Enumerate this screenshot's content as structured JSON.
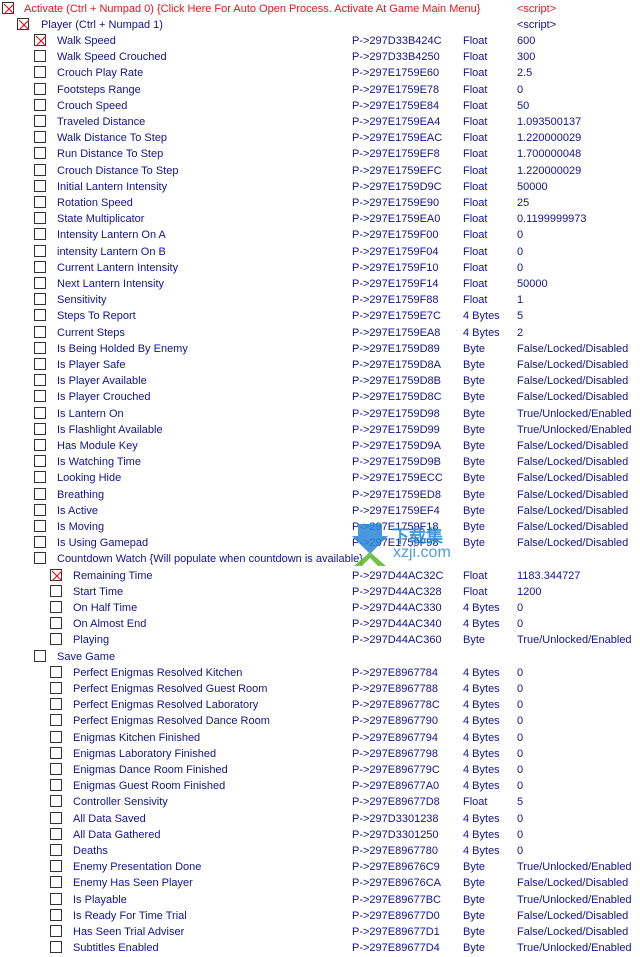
{
  "colors": {
    "text": "#14148c",
    "script_row": "#e8141e",
    "check_x": "#e8141e"
  },
  "watermark": {
    "line1": "下载集",
    "line2": "xzji.com"
  },
  "rows": [
    {
      "level": 0,
      "checked": true,
      "red": true,
      "desc": "Activate (Ctrl + Numpad 0) {Click Here For Auto Open Process. Activate At Game Main Menu}",
      "addr": "",
      "type": "",
      "value": "<script>"
    },
    {
      "level": 1,
      "checked": true,
      "desc": "Player (Ctrl + Numpad 1)",
      "addr": "",
      "type": "",
      "value": "<script>"
    },
    {
      "level": 2,
      "checked": true,
      "desc": "Walk Speed",
      "addr": "P->297D33B424C",
      "type": "Float",
      "value": "600"
    },
    {
      "level": 2,
      "desc": "Walk Speed Crouched",
      "addr": "P->297D33B4250",
      "type": "Float",
      "value": "300"
    },
    {
      "level": 2,
      "desc": "Crouch Play Rate",
      "addr": "P->297E1759E60",
      "type": "Float",
      "value": "2.5"
    },
    {
      "level": 2,
      "desc": "Footsteps Range",
      "addr": "P->297E1759E78",
      "type": "Float",
      "value": "0"
    },
    {
      "level": 2,
      "desc": "Crouch Speed",
      "addr": "P->297E1759E84",
      "type": "Float",
      "value": "50"
    },
    {
      "level": 2,
      "desc": "Traveled Distance",
      "addr": "P->297E1759EA4",
      "type": "Float",
      "value": "1.093500137"
    },
    {
      "level": 2,
      "desc": "Walk Distance To Step",
      "addr": "P->297E1759EAC",
      "type": "Float",
      "value": "1.220000029"
    },
    {
      "level": 2,
      "desc": "Run Distance To Step",
      "addr": "P->297E1759EF8",
      "type": "Float",
      "value": "1.700000048"
    },
    {
      "level": 2,
      "desc": "Crouch Distance To Step",
      "addr": "P->297E1759EFC",
      "type": "Float",
      "value": "1.220000029"
    },
    {
      "level": 2,
      "desc": "Initial Lantern Intensity",
      "addr": "P->297E1759D9C",
      "type": "Float",
      "value": "50000"
    },
    {
      "level": 2,
      "desc": "Rotation Speed",
      "addr": "P->297E1759E90",
      "type": "Float",
      "value": "25"
    },
    {
      "level": 2,
      "desc": "State Multiplicator",
      "addr": "P->297E1759EA0",
      "type": "Float",
      "value": "0.1199999973"
    },
    {
      "level": 2,
      "desc": "Intensity Lantern On A",
      "addr": "P->297E1759F00",
      "type": "Float",
      "value": "0"
    },
    {
      "level": 2,
      "desc": "intensity Lantern On B",
      "addr": "P->297E1759F04",
      "type": "Float",
      "value": "0"
    },
    {
      "level": 2,
      "desc": "Current Lantern Intensity",
      "addr": "P->297E1759F10",
      "type": "Float",
      "value": "0"
    },
    {
      "level": 2,
      "desc": "Next Lantern Intensity",
      "addr": "P->297E1759F14",
      "type": "Float",
      "value": "50000"
    },
    {
      "level": 2,
      "desc": "Sensitivity",
      "addr": "P->297E1759F88",
      "type": "Float",
      "value": "1"
    },
    {
      "level": 2,
      "desc": "Steps To Report",
      "addr": "P->297E1759E7C",
      "type": "4 Bytes",
      "value": "5"
    },
    {
      "level": 2,
      "desc": "Current Steps",
      "addr": "P->297E1759EA8",
      "type": "4 Bytes",
      "value": "2"
    },
    {
      "level": 2,
      "desc": "Is Being Holded By Enemy",
      "addr": "P->297E1759D89",
      "type": "Byte",
      "value": "False/Locked/Disabled"
    },
    {
      "level": 2,
      "desc": "Is Player Safe",
      "addr": "P->297E1759D8A",
      "type": "Byte",
      "value": "False/Locked/Disabled"
    },
    {
      "level": 2,
      "desc": "Is Player Available",
      "addr": "P->297E1759D8B",
      "type": "Byte",
      "value": "False/Locked/Disabled"
    },
    {
      "level": 2,
      "desc": "Is Player Crouched",
      "addr": "P->297E1759D8C",
      "type": "Byte",
      "value": "False/Locked/Disabled"
    },
    {
      "level": 2,
      "desc": "Is Lantern On",
      "addr": "P->297E1759D98",
      "type": "Byte",
      "value": "True/Unlocked/Enabled"
    },
    {
      "level": 2,
      "desc": "Is Flashlight Available",
      "addr": "P->297E1759D99",
      "type": "Byte",
      "value": "True/Unlocked/Enabled"
    },
    {
      "level": 2,
      "desc": "Has Module Key",
      "addr": "P->297E1759D9A",
      "type": "Byte",
      "value": "False/Locked/Disabled"
    },
    {
      "level": 2,
      "desc": "Is Watching Time",
      "addr": "P->297E1759D9B",
      "type": "Byte",
      "value": "False/Locked/Disabled"
    },
    {
      "level": 2,
      "desc": "Looking Hide",
      "addr": "P->297E1759ECC",
      "type": "Byte",
      "value": "False/Locked/Disabled"
    },
    {
      "level": 2,
      "desc": "Breathing",
      "addr": "P->297E1759ED8",
      "type": "Byte",
      "value": "False/Locked/Disabled"
    },
    {
      "level": 2,
      "desc": "Is Active",
      "addr": "P->297E1759EF4",
      "type": "Byte",
      "value": "False/Locked/Disabled"
    },
    {
      "level": 2,
      "desc": "Is Moving",
      "addr": "P->297E1759F18",
      "type": "Byte",
      "value": "False/Locked/Disabled"
    },
    {
      "level": 2,
      "desc": "Is Using Gamepad",
      "addr": "P->297E1759F98",
      "type": "Byte",
      "value": "False/Locked/Disabled"
    },
    {
      "level": 2,
      "desc": "Countdown Watch {Will populate when countdown is available}",
      "addr": "",
      "type": "",
      "value": ""
    },
    {
      "level": 3,
      "checked": true,
      "desc": "Remaining Time",
      "addr": "P->297D44AC32C",
      "type": "Float",
      "value": "1183.344727"
    },
    {
      "level": 3,
      "desc": "Start Time",
      "addr": "P->297D44AC328",
      "type": "Float",
      "value": "1200"
    },
    {
      "level": 3,
      "desc": "On Half Time",
      "addr": "P->297D44AC330",
      "type": "4 Bytes",
      "value": "0"
    },
    {
      "level": 3,
      "desc": "On Almost End",
      "addr": "P->297D44AC340",
      "type": "4 Bytes",
      "value": "0"
    },
    {
      "level": 3,
      "desc": "Playing",
      "addr": "P->297D44AC360",
      "type": "Byte",
      "value": "True/Unlocked/Enabled"
    },
    {
      "level": 2,
      "desc": "Save Game",
      "addr": "",
      "type": "",
      "value": ""
    },
    {
      "level": 3,
      "desc": "Perfect Enigmas Resolved Kitchen",
      "addr": "P->297E8967784",
      "type": "4 Bytes",
      "value": "0"
    },
    {
      "level": 3,
      "desc": "Perfect Enigmas Resolved Guest Room",
      "addr": "P->297E8967788",
      "type": "4 Bytes",
      "value": "0"
    },
    {
      "level": 3,
      "desc": "Perfect Enigmas Resolved Laboratory",
      "addr": "P->297E896778C",
      "type": "4 Bytes",
      "value": "0"
    },
    {
      "level": 3,
      "desc": "Perfect Enigmas Resolved Dance Room",
      "addr": "P->297E8967790",
      "type": "4 Bytes",
      "value": "0"
    },
    {
      "level": 3,
      "desc": "Enigmas Kitchen Finished",
      "addr": "P->297E8967794",
      "type": "4 Bytes",
      "value": "0"
    },
    {
      "level": 3,
      "desc": "Enigmas Laboratory Finished",
      "addr": "P->297E8967798",
      "type": "4 Bytes",
      "value": "0"
    },
    {
      "level": 3,
      "desc": "Enigmas Dance Room Finished",
      "addr": "P->297E896779C",
      "type": "4 Bytes",
      "value": "0"
    },
    {
      "level": 3,
      "desc": "Enigmas Guest Room Finished",
      "addr": "P->297E89677A0",
      "type": "4 Bytes",
      "value": "0"
    },
    {
      "level": 3,
      "desc": "Controller Sensivity",
      "addr": "P->297E89677D8",
      "type": "Float",
      "value": "5"
    },
    {
      "level": 3,
      "desc": "All Data Saved",
      "addr": "P->297D3301238",
      "type": "4 Bytes",
      "value": "0"
    },
    {
      "level": 3,
      "desc": "All Data Gathered",
      "addr": "P->297D3301250",
      "type": "4 Bytes",
      "value": "0"
    },
    {
      "level": 3,
      "desc": "Deaths",
      "addr": "P->297E8967780",
      "type": "4 Bytes",
      "value": "0"
    },
    {
      "level": 3,
      "desc": "Enemy Presentation Done",
      "addr": "P->297E89676C9",
      "type": "Byte",
      "value": "True/Unlocked/Enabled"
    },
    {
      "level": 3,
      "desc": "Enemy Has Seen Player",
      "addr": "P->297E89676CA",
      "type": "Byte",
      "value": "False/Locked/Disabled"
    },
    {
      "level": 3,
      "desc": "Is Playable",
      "addr": "P->297E89677BC",
      "type": "Byte",
      "value": "True/Unlocked/Enabled"
    },
    {
      "level": 3,
      "desc": "Is Ready For Time Trial",
      "addr": "P->297E89677D0",
      "type": "Byte",
      "value": "False/Locked/Disabled"
    },
    {
      "level": 3,
      "desc": "Has Seen Trial Adviser",
      "addr": "P->297E89677D1",
      "type": "Byte",
      "value": "False/Locked/Disabled"
    },
    {
      "level": 3,
      "desc": "Subtitles Enabled",
      "addr": "P->297E89677D4",
      "type": "Byte",
      "value": "True/Unlocked/Enabled"
    }
  ]
}
